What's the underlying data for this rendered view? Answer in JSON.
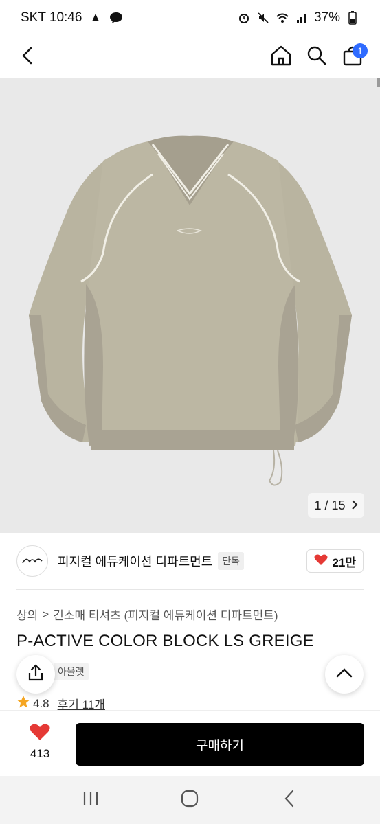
{
  "status_bar": {
    "carrier_time": "SKT 10:46",
    "battery": "37%"
  },
  "header": {
    "cart_count": "1"
  },
  "gallery": {
    "current": "1",
    "separator": "/",
    "total": "15"
  },
  "brand": {
    "name": "피지컬 에듀케이션 디파트먼트",
    "tag": "단독",
    "likes": "21만"
  },
  "breadcrumb": {
    "level1": "상의",
    "sep": ">",
    "level2": "긴소매 티셔츠 (피지컬 에듀케이션 디파트먼트)"
  },
  "product": {
    "title": "P-ACTIVE COLOR BLOCK LS GREIGE",
    "tag": "아울렛",
    "rating": "4.8",
    "review_label": "후기 11개"
  },
  "purchase": {
    "wish_count": "413",
    "buy_label": "구매하기"
  },
  "colors": {
    "accent": "#2f6bff",
    "heart": "#e53935",
    "star": "#f5a623",
    "buy_bg": "#000000",
    "garment": "#b9b4a0"
  },
  "icons": [
    "back-icon",
    "home-icon",
    "search-icon",
    "cart-icon",
    "chevron-right-icon",
    "share-icon",
    "chevron-up-icon",
    "heart-icon",
    "star-icon",
    "recent-apps-icon",
    "home-circle-icon",
    "back-nav-icon"
  ]
}
